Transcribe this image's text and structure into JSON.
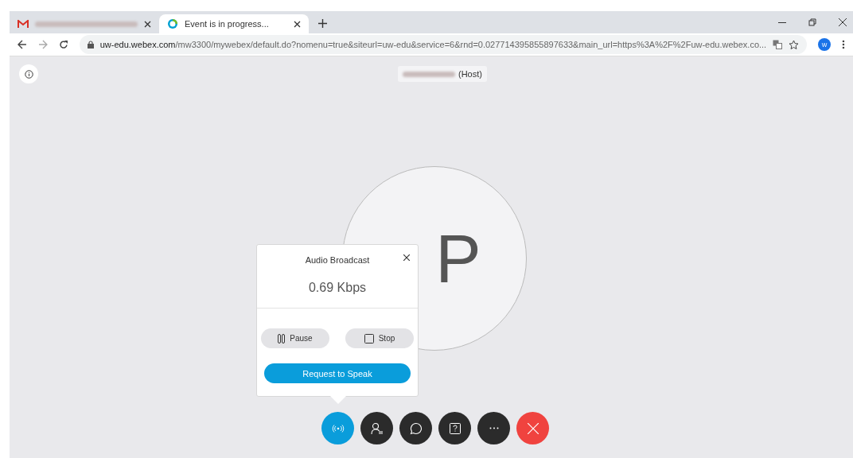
{
  "browser": {
    "tabs": [
      {
        "kind": "gmail",
        "selected": false
      },
      {
        "kind": "webex",
        "title": "Event is in progress...",
        "selected": true
      }
    ],
    "url": {
      "host": "uw-edu.webex.com",
      "path": "/mw3300/mywebex/default.do?nomenu=true&siteurl=uw-edu&service=6&rnd=0.027714395855897633&main_url=https%3A%2F%2Fuw-edu.webex.co..."
    },
    "profile_initial": "W"
  },
  "meeting": {
    "host_label": "(Host)",
    "avatar_initials": "P",
    "popup": {
      "title": "Audio Broadcast",
      "bitrate": "0.69 Kbps",
      "buttons": [
        {
          "kind": "pause",
          "label": "Pause"
        },
        {
          "kind": "stop",
          "label": "Stop"
        }
      ],
      "primary": "Request to Speak"
    },
    "controls": [
      {
        "kind": "audio",
        "selected": true
      },
      {
        "kind": "participants",
        "selected": false
      },
      {
        "kind": "chat",
        "selected": false
      },
      {
        "kind": "qa",
        "selected": false
      },
      {
        "kind": "more",
        "selected": false
      },
      {
        "kind": "leave",
        "selected": false
      }
    ]
  }
}
